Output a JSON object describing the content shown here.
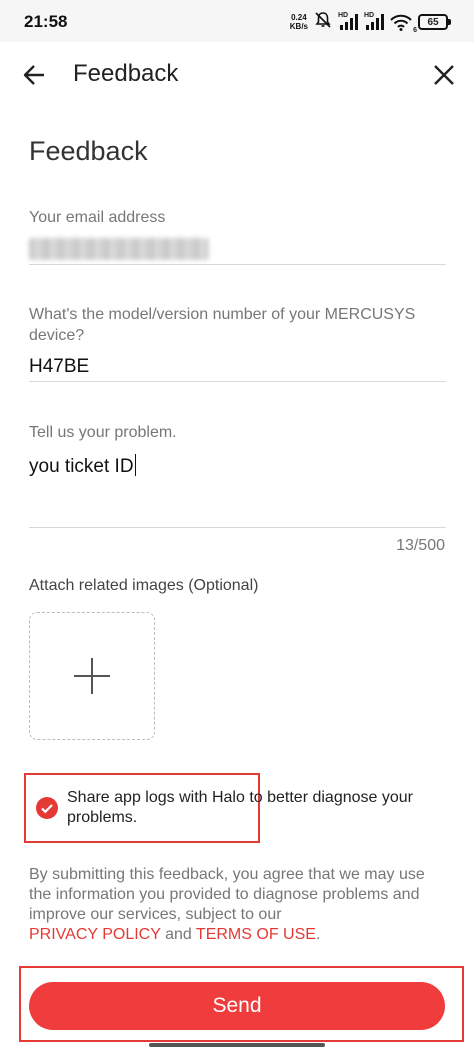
{
  "status_bar": {
    "time": "21:58",
    "net_speed_value": "0.24",
    "net_speed_unit": "KB/s",
    "signal1_label": "HD",
    "signal2_label": "HD",
    "wifi_label": "6",
    "battery": "65",
    "icons": [
      "mute-bell-icon",
      "signal-icon",
      "signal-icon",
      "wifi-icon",
      "battery-icon"
    ]
  },
  "header": {
    "title": "Feedback",
    "back_icon": "arrow-left-icon",
    "close_icon": "close-icon"
  },
  "form": {
    "title": "Feedback",
    "email": {
      "label": "Your email address"
    },
    "model": {
      "label": "What's the model/version number of your MERCUSYS device?",
      "value": "H47BE"
    },
    "problem": {
      "label": "Tell us your problem.",
      "value": "you ticket ID",
      "counter": "13/500"
    },
    "attach": {
      "label": "Attach related images (Optional)",
      "icon": "plus-icon"
    },
    "share_logs": {
      "checked": true,
      "text": "Share app logs with Halo to better diagnose your problems."
    },
    "disclaimer": {
      "text": "By submitting this feedback, you agree that we may use the information you provided to diagnose problems and improve our services, subject to our",
      "privacy_link": "PRIVACY POLICY",
      "and": "and",
      "terms_link": "TERMS OF USE",
      "end": "."
    },
    "send_label": "Send"
  },
  "colors": {
    "accent": "#f03c3c",
    "highlight_box": "#e53935",
    "label": "#777777",
    "text": "#222222"
  }
}
